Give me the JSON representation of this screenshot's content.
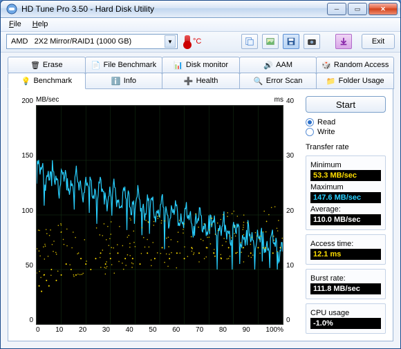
{
  "window": {
    "title": "HD Tune Pro 3.50 - Hard Disk Utility"
  },
  "menu": {
    "file": "File",
    "help": "Help"
  },
  "toolbar": {
    "drive_vendor": "AMD",
    "drive_model": "2X2 Mirror/RAID1 (1000 GB)",
    "temp_label": "°C",
    "exit": "Exit",
    "icons": [
      "copy-text-icon",
      "copy-image-icon",
      "save-icon",
      "camera-icon",
      "options-icon"
    ]
  },
  "tabs_row1": [
    {
      "id": "erase",
      "label": "Erase"
    },
    {
      "id": "filebench",
      "label": "File Benchmark"
    },
    {
      "id": "diskmon",
      "label": "Disk monitor"
    },
    {
      "id": "aam",
      "label": "AAM"
    },
    {
      "id": "random",
      "label": "Random Access"
    }
  ],
  "tabs_row2": [
    {
      "id": "benchmark",
      "label": "Benchmark"
    },
    {
      "id": "info",
      "label": "Info"
    },
    {
      "id": "health",
      "label": "Health"
    },
    {
      "id": "errorscan",
      "label": "Error Scan"
    },
    {
      "id": "folder",
      "label": "Folder Usage"
    }
  ],
  "active_tab": "benchmark",
  "chart": {
    "left_unit": "MB/sec",
    "right_unit": "ms",
    "y_left": [
      200,
      150,
      100,
      50,
      0
    ],
    "y_right": [
      40,
      30,
      20,
      10,
      0
    ],
    "x_ticks": [
      "0",
      "10",
      "20",
      "30",
      "40",
      "50",
      "60",
      "70",
      "80",
      "90",
      "100%"
    ]
  },
  "controls": {
    "start": "Start",
    "mode_read": "Read",
    "mode_write": "Write",
    "mode_selected": "read"
  },
  "metrics": {
    "transfer_label": "Transfer rate",
    "min_label": "Minimum",
    "min_val": "53.3 MB/sec",
    "max_label": "Maximum",
    "max_val": "147.6 MB/sec",
    "avg_label": "Average:",
    "avg_val": "110.0 MB/sec",
    "access_label": "Access time:",
    "access_val": "12.1 ms",
    "burst_label": "Burst rate:",
    "burst_val": "111.8 MB/sec",
    "cpu_label": "CPU usage",
    "cpu_val": "-1.0%"
  },
  "chart_data": {
    "type": "line+scatter",
    "title": "Benchmark",
    "x_unit": "% drive position",
    "x_range": [
      0,
      100
    ],
    "series": [
      {
        "name": "Transfer rate",
        "axis": "left",
        "unit": "MB/sec",
        "y_range": [
          0,
          200
        ],
        "color": "#29d0ff",
        "x": [
          0,
          5,
          10,
          15,
          20,
          25,
          30,
          35,
          40,
          45,
          50,
          55,
          60,
          65,
          70,
          75,
          80,
          85,
          90,
          95,
          100
        ],
        "y": [
          138,
          142,
          140,
          135,
          136,
          130,
          128,
          127,
          125,
          120,
          118,
          112,
          108,
          105,
          100,
          97,
          92,
          88,
          82,
          78,
          72
        ]
      },
      {
        "name": "Access time",
        "axis": "right",
        "unit": "ms",
        "y_range": [
          0,
          40
        ],
        "color": "#ffde00",
        "type": "scatter",
        "x": [
          1,
          2,
          3,
          4,
          5,
          6,
          8,
          10,
          12,
          14,
          16,
          18,
          20,
          22,
          24,
          26,
          28,
          30,
          33,
          36,
          39,
          42,
          45,
          48,
          51,
          54,
          57,
          60,
          63,
          66,
          69,
          72,
          75,
          78,
          81,
          84,
          87,
          90,
          93,
          96,
          99
        ],
        "y": [
          7,
          6,
          9,
          8,
          7,
          10,
          8,
          9,
          11,
          10,
          9,
          12,
          11,
          10,
          12,
          13,
          11,
          12,
          13,
          12,
          12,
          11,
          13,
          12,
          14,
          12,
          13,
          12,
          14,
          13,
          14,
          13,
          12,
          14,
          13,
          14,
          13,
          14,
          14,
          13,
          14
        ]
      }
    ],
    "summary": {
      "min_mbps": 53.3,
      "max_mbps": 147.6,
      "avg_mbps": 110.0,
      "access_ms": 12.1,
      "burst_mbps": 111.8,
      "cpu_pct": -1.0
    }
  }
}
